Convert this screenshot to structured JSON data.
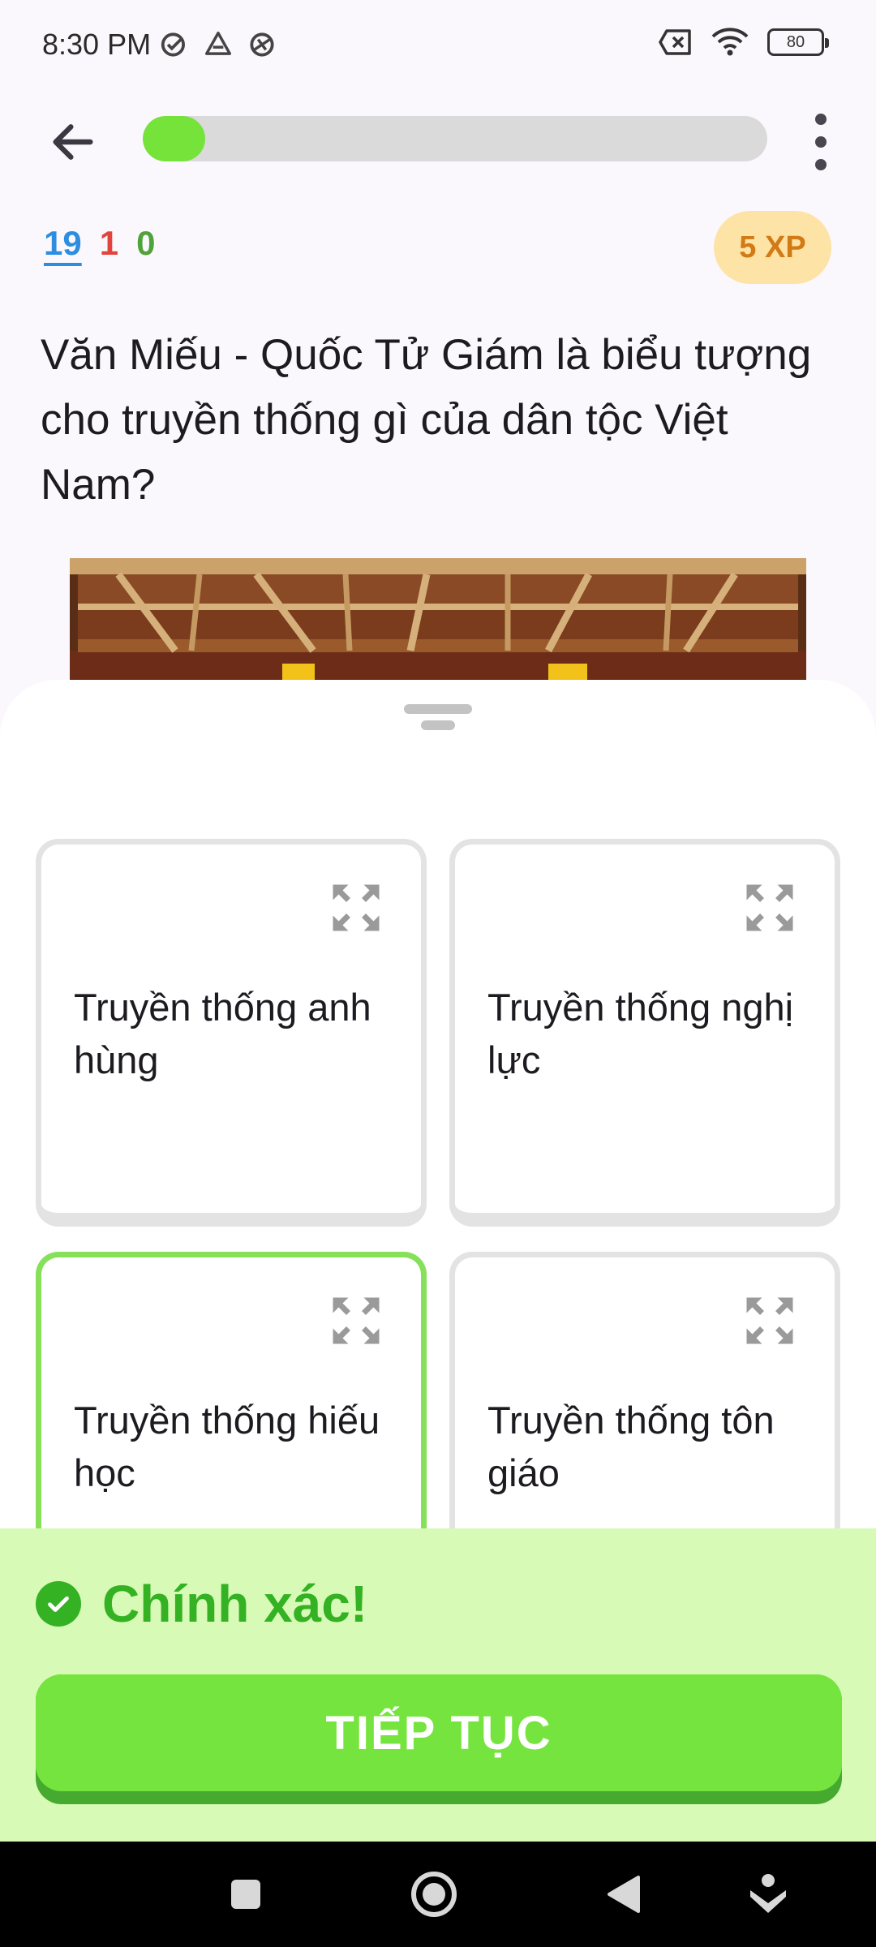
{
  "status_bar": {
    "time": "8:30 PM",
    "left_icons": [
      "check-circle-icon",
      "drive-icon",
      "vpn-icon"
    ],
    "right_icons": [
      "no-sim-icon",
      "wifi-icon"
    ],
    "battery": "80"
  },
  "header": {
    "progress_percent": 10
  },
  "counters": {
    "total": "19",
    "wrong": "1",
    "correct": "0"
  },
  "xp_badge": "5 XP",
  "question": "Văn Miếu - Quốc Tử Giám là biểu tượng cho truyền thống gì của dân tộc Việt Nam?",
  "options": [
    {
      "label": "Truyền thống anh hùng",
      "selected": false
    },
    {
      "label": "Truyền thống nghị lực",
      "selected": false
    },
    {
      "label": "Truyền thống hiếu học",
      "selected": true
    },
    {
      "label": "Truyền thống tôn giáo",
      "selected": false
    }
  ],
  "result": {
    "message": "Chính xác!",
    "continue_label": "TIẾP TỤC",
    "accent": "#35b124"
  },
  "colors": {
    "progress": "#75e33a",
    "selected_border": "#86e05a",
    "banner_bg": "#d7fbb6",
    "button": "#76e43f"
  }
}
